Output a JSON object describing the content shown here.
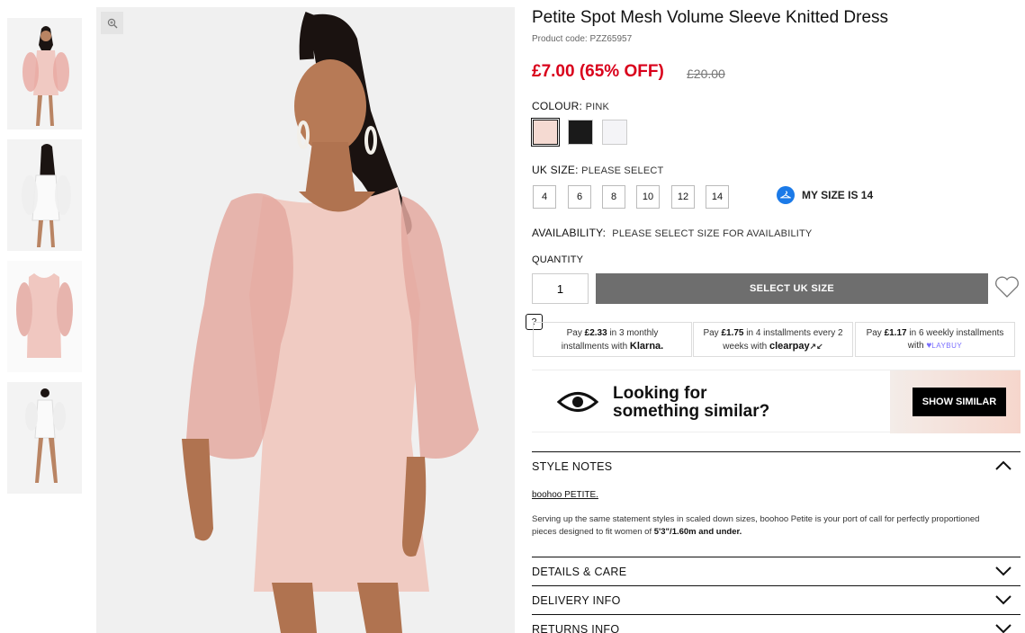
{
  "thumbnails": [
    {
      "alt": "thumbnail-front"
    },
    {
      "alt": "thumbnail-back"
    },
    {
      "alt": "thumbnail-flat"
    },
    {
      "alt": "thumbnail-full"
    }
  ],
  "product": {
    "title": "Petite Spot Mesh Volume Sleeve Knitted Dress",
    "code": "Product code: PZZ65957",
    "price": "£7.00 (65% OFF)",
    "was_price": "£20.00"
  },
  "colour": {
    "label": "COLOUR:",
    "selected": "PINK",
    "swatches": [
      "#f5dad2",
      "#1a1a1a",
      "#f4f4f7"
    ]
  },
  "size": {
    "label": "UK SIZE:",
    "selected": "PLEASE SELECT",
    "options": [
      "4",
      "6",
      "8",
      "10",
      "12",
      "14"
    ],
    "my_size": "MY SIZE IS 14"
  },
  "availability": {
    "label": "AVAILABILITY:",
    "value": "PLEASE SELECT SIZE FOR AVAILABILITY"
  },
  "quantity": {
    "label": "QUANTITY",
    "value": "1"
  },
  "add_button": "SELECT UK SIZE",
  "payments": {
    "help": "?",
    "klarna": {
      "pre": "Pay ",
      "amt": "£2.33",
      "mid": " in 3 monthly",
      "line2": "installments with ",
      "brand": "Klarna."
    },
    "clearpay": {
      "pre": "Pay ",
      "amt": "£1.75",
      "mid": " in 4 installments every 2",
      "line2": "weeks with ",
      "brand": "clearpay"
    },
    "laybuy": {
      "pre": "Pay ",
      "amt": "£1.17",
      "mid": " in 6 weekly installments",
      "line2": "with ",
      "brand": "LAYBUY"
    }
  },
  "similar": {
    "line1": "Looking for",
    "line2": "something similar?",
    "button": "SHOW SIMILAR"
  },
  "style_notes": {
    "heading": "STYLE NOTES",
    "brand_link": "boohoo PETITE.",
    "desc_a": "Serving up the same statement styles in scaled down sizes, boohoo Petite is your port of call for perfectly proportioned pieces designed to fit women of ",
    "desc_b": "5'3\"/1.60m and under."
  },
  "accordions": [
    "DETAILS & CARE",
    "DELIVERY INFO",
    "RETURNS INFO"
  ]
}
